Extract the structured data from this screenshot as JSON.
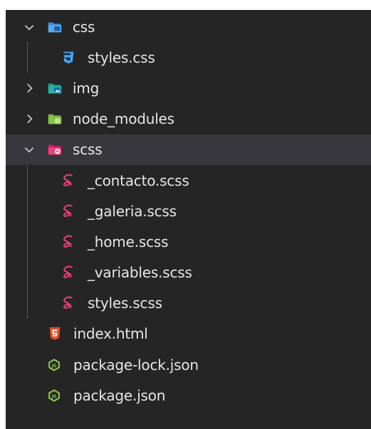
{
  "explorer": {
    "items": [
      {
        "label": "css",
        "kind": "folder",
        "state": "expanded",
        "icon": "css-folder-icon"
      },
      {
        "label": "styles.css",
        "kind": "file",
        "icon": "css-file-icon"
      },
      {
        "label": "img",
        "kind": "folder",
        "state": "collapsed",
        "icon": "image-folder-icon"
      },
      {
        "label": "node_modules",
        "kind": "folder",
        "state": "collapsed",
        "icon": "node-folder-icon"
      },
      {
        "label": "scss",
        "kind": "folder",
        "state": "expanded",
        "selected": true,
        "icon": "sass-folder-icon"
      },
      {
        "label": "_contacto.scss",
        "kind": "file",
        "icon": "sass-file-icon"
      },
      {
        "label": "_galeria.scss",
        "kind": "file",
        "icon": "sass-file-icon"
      },
      {
        "label": "_home.scss",
        "kind": "file",
        "icon": "sass-file-icon"
      },
      {
        "label": "_variables.scss",
        "kind": "file",
        "icon": "sass-file-icon"
      },
      {
        "label": "styles.scss",
        "kind": "file",
        "icon": "sass-file-icon"
      },
      {
        "label": "index.html",
        "kind": "file",
        "icon": "html5-file-icon"
      },
      {
        "label": "package-lock.json",
        "kind": "file",
        "icon": "nodejs-file-icon"
      },
      {
        "label": "package.json",
        "kind": "file",
        "icon": "nodejs-file-icon"
      }
    ]
  },
  "colors": {
    "panel_bg": "#252526",
    "selected_bg": "#37373d",
    "text": "#e6e6e6",
    "css_blue": "#42a5f5",
    "sass_pink": "#ec407a",
    "html_orange": "#e44d26",
    "node_green": "#8bc34a"
  }
}
